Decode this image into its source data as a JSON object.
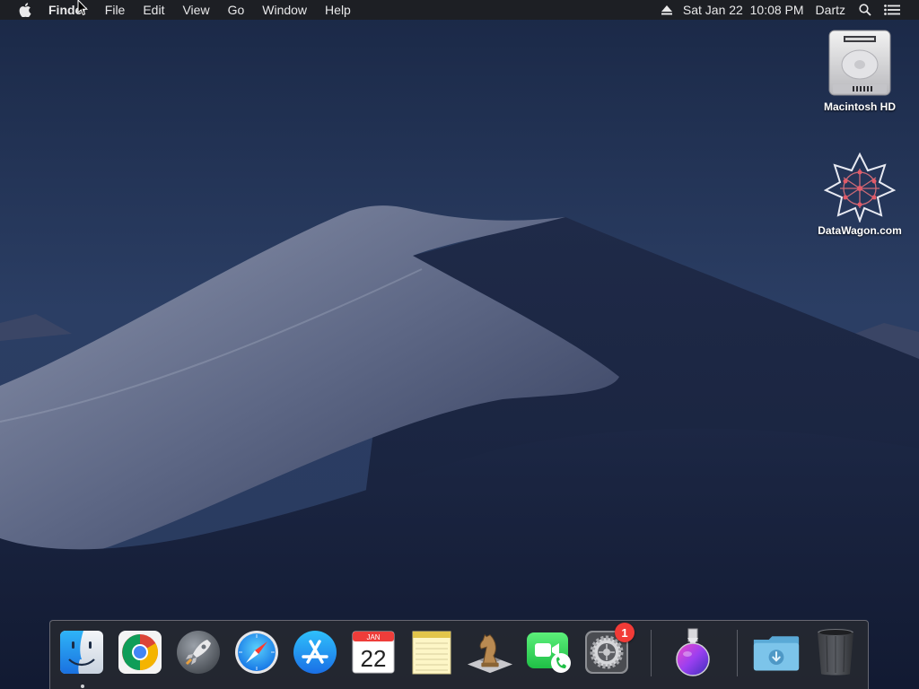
{
  "menubar": {
    "app_name": "Finder",
    "menus": [
      "File",
      "Edit",
      "View",
      "Go",
      "Window",
      "Help"
    ],
    "datetime": "Sat Jan 22  10:08 PM",
    "user": "Dartz"
  },
  "desktop": {
    "icons": [
      {
        "label": "Macintosh HD",
        "icon": "hard-drive-icon"
      },
      {
        "label": "DataWagon.com",
        "icon": "datawagon-logo-icon"
      }
    ]
  },
  "dock": {
    "apps": [
      {
        "name": "Finder",
        "icon": "finder-icon",
        "running": true
      },
      {
        "name": "Google Chrome",
        "icon": "chrome-icon"
      },
      {
        "name": "Launchpad",
        "icon": "launchpad-rocket-icon"
      },
      {
        "name": "Safari",
        "icon": "safari-compass-icon"
      },
      {
        "name": "App Store",
        "icon": "app-store-icon"
      },
      {
        "name": "Calendar",
        "icon": "calendar-icon",
        "month": "JAN",
        "day": "22"
      },
      {
        "name": "Notes",
        "icon": "notes-icon"
      },
      {
        "name": "Chess",
        "icon": "chess-knight-icon"
      },
      {
        "name": "FaceTime",
        "icon": "facetime-icon"
      },
      {
        "name": "System Preferences",
        "icon": "gear-icon",
        "badge": "1"
      },
      {
        "name": "Installer",
        "icon": "installer-flask-icon"
      },
      {
        "name": "Downloads",
        "icon": "downloads-folder-icon"
      },
      {
        "name": "Trash",
        "icon": "trash-icon"
      }
    ]
  },
  "colors": {
    "menubar": "#1d1f24",
    "badge": "#f23b37",
    "sky": "#1b2a4a"
  }
}
